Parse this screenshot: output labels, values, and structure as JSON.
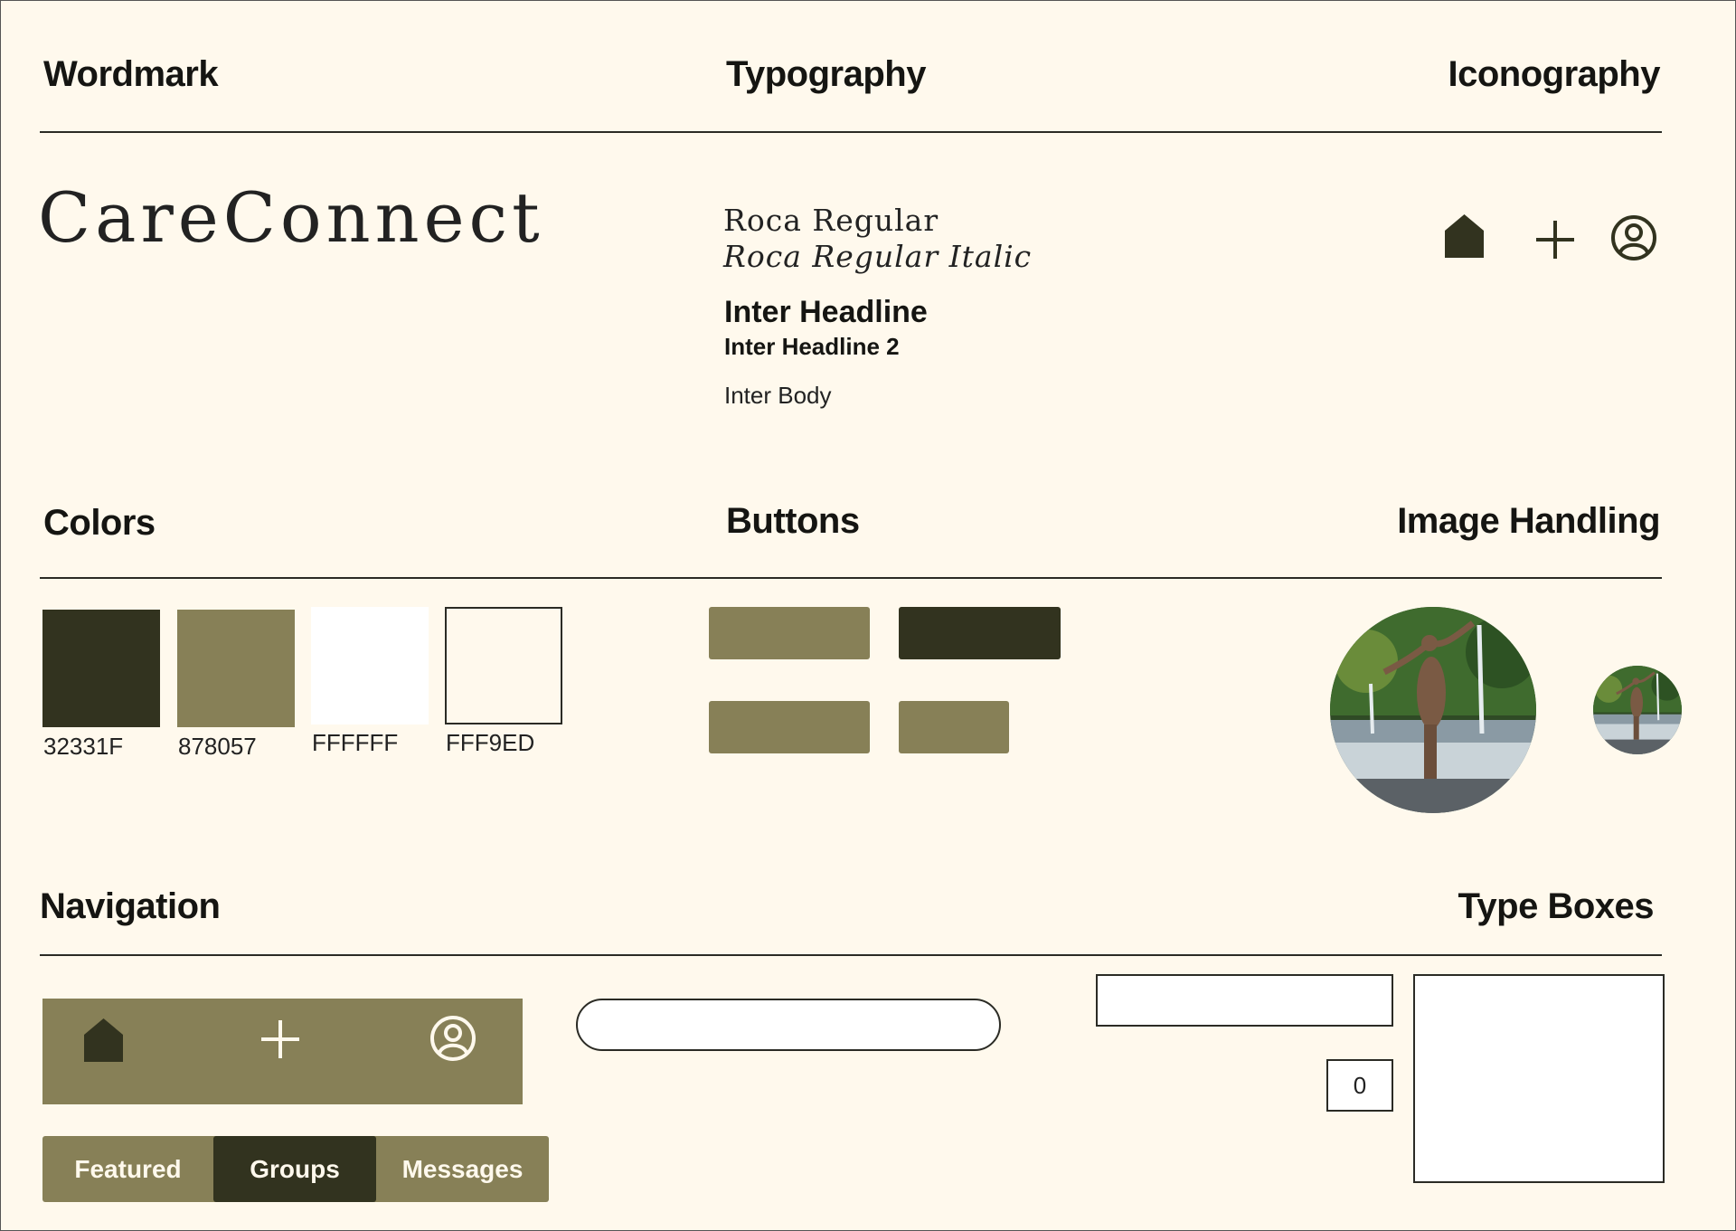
{
  "sections": {
    "wordmark": "Wordmark",
    "typography": "Typography",
    "iconography": "Iconography",
    "colors": "Colors",
    "buttons": "Buttons",
    "image_handling": "Image Handling",
    "navigation": "Navigation",
    "type_boxes": "Type Boxes"
  },
  "brand": {
    "wordmark": "CareConnect"
  },
  "typography": {
    "roca_regular": "Roca Regular",
    "roca_regular_italic": "Roca Regular Italic",
    "inter_headline": "Inter Headline",
    "inter_headline_2": "Inter Headline 2",
    "inter_body": "Inter Body"
  },
  "icons": [
    "home-icon",
    "plus-icon",
    "user-icon"
  ],
  "colors": [
    {
      "hex": "#32331F",
      "label": "32331F"
    },
    {
      "hex": "#878057",
      "label": "878057"
    },
    {
      "hex": "#FFFFFF",
      "label": "FFFFFF"
    },
    {
      "hex": "#FFF9ED",
      "label": "FFF9ED"
    }
  ],
  "navigation": {
    "icons": [
      "home-icon",
      "plus-icon",
      "user-icon"
    ],
    "tabs": [
      {
        "label": "Featured",
        "active": false
      },
      {
        "label": "Groups",
        "active": true
      },
      {
        "label": "Messages",
        "active": false
      }
    ]
  },
  "type_boxes": {
    "number_value": "0"
  }
}
